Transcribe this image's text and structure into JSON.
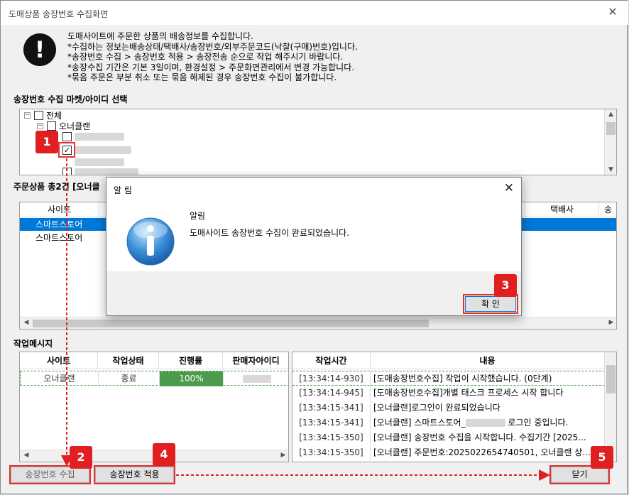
{
  "window": {
    "title": "도매상품 송장번호 수집화면",
    "close_glyph": "✕"
  },
  "notice": {
    "lines": [
      "도매사이트에 주문한 상품의 배송정보를 수집합니다.",
      "*수집하는 정보는배송상태/택배사/송장번호/외부주문코드(낙찰(구매)번호)입니다.",
      "*송장번호 수집 > 송장번호 적용 > 송장전송 순으로 작업 해주시기 바랍니다.",
      "*송장수집 기간은 기본 3일이며, 환경설정 > 주문화면관리에서 변경 가능합니다.",
      "*묶음 주문은 부분 취소 또는 묶음 해제된 경우 송장번호 수집이 불가합니다."
    ]
  },
  "tree_section": {
    "label": "송장번호 수집 마켓/아이디 선택",
    "root_label": "전체",
    "child_label": "오너클랜",
    "checked_glyph": "✓"
  },
  "orders_section": {
    "label": "주문상품 총2건 [오너클",
    "columns": [
      "사이트",
      "택배사"
    ],
    "rows": [
      "스마트스토어",
      "스마트스토어"
    ]
  },
  "work_section": {
    "label": "작업메시지",
    "status_columns": [
      "사이트",
      "작업상태",
      "진행률",
      "판매자아이디"
    ],
    "status_row": {
      "site": "오너클랜",
      "state": "종료",
      "progress": "100%"
    },
    "log_columns": [
      "작업시간",
      "내용"
    ],
    "log_rows": [
      {
        "time": "[13:34:14-930]",
        "msg": "[도매송장번호수집] 작업이 시작했습니다. (0단계)"
      },
      {
        "time": "[13:34:14-945]",
        "msg": "[도매송장번호수집]개별 태스크 프로세스 시작 합니다"
      },
      {
        "time": "[13:34:15-341]",
        "msg": "[오너클랜]로그인이 완료되었습니다"
      },
      {
        "time": "[13:34:15-341]",
        "msg": "[오너클랜] 스마트스토어_",
        "msg_tail": " 로그인 중입니다."
      },
      {
        "time": "[13:34:15-350]",
        "msg": "[오너클랜] 송장번호 수집을 시작합니다. 수집기간 [2025..."
      },
      {
        "time": "[13:34:15-350]",
        "msg": "[오너클랜] 주문번호:2025022654740501, 오너클랜 상..."
      }
    ]
  },
  "buttons": {
    "collect": "송장번호 수집",
    "apply": "송장번호 적용",
    "close": "닫기"
  },
  "dialog": {
    "title": "알 림",
    "close_glyph": "✕",
    "heading": "알림",
    "message": "도매사이트 송장번호 수집이 완료되었습니다.",
    "ok": "확 인",
    "icon_glyph": "i"
  },
  "markers": [
    "1",
    "2",
    "3",
    "4",
    "5"
  ],
  "colors": {
    "accent_selected": "#0078d7",
    "marker_red": "#e02020",
    "progress_green": "#4c9a4c"
  }
}
